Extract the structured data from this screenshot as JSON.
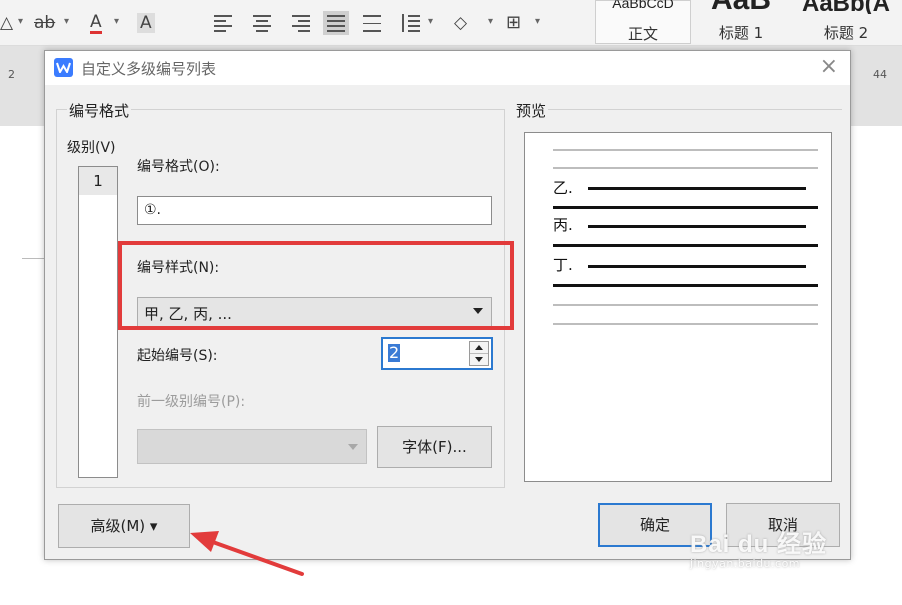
{
  "ribbon": {
    "font_color_glyph": "A",
    "char_shading_glyph": "A",
    "strike_glyph": "ab",
    "styles": [
      {
        "sample": "AaBbCcD",
        "label": "正文"
      },
      {
        "sample": "AaB",
        "label": "标题 1"
      },
      {
        "sample": "AaBb(A",
        "label": "标题 2"
      }
    ],
    "ruler": {
      "left": "2",
      "right": "44"
    }
  },
  "dialog": {
    "title": "自定义多级编号列表",
    "close_glyph": "×",
    "number_format_group": "编号格式",
    "level_label": "级别(V)",
    "levels": [
      "1"
    ],
    "format_label": "编号格式(O):",
    "format_value": "①.",
    "style_label": "编号样式(N):",
    "style_value": "甲, 乙, 丙, ...",
    "start_label": "起始编号(S):",
    "start_value": "2",
    "prev_level_label": "前一级别编号(P):",
    "font_button": "字体(F)...",
    "advanced_button": "高级(M) ▾",
    "ok_button": "确定",
    "cancel_button": "取消",
    "preview_group": "预览",
    "preview_items": [
      "乙.",
      "丙.",
      "丁."
    ]
  },
  "watermark": {
    "brand": "Bai du 经验",
    "url": "jingyan.baidu.com"
  },
  "colors": {
    "accent_blue": "#2b79d0",
    "highlight_red": "#e23b3b",
    "dialog_bg": "#f0f0f0"
  }
}
